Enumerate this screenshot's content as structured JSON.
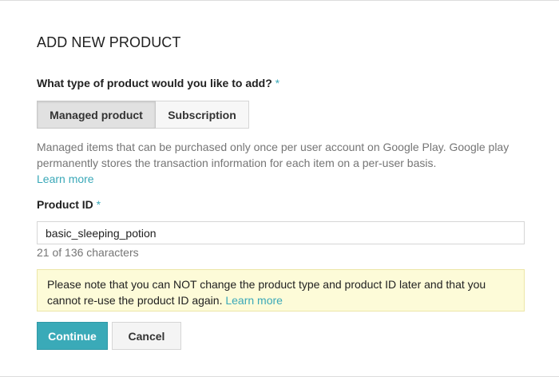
{
  "dialog": {
    "title": "ADD NEW PRODUCT",
    "product_type": {
      "question": "What type of product would you like to add?",
      "required_mark": "*",
      "options": [
        {
          "label": "Managed product",
          "selected": true
        },
        {
          "label": "Subscription",
          "selected": false
        }
      ],
      "description": "Managed items that can be purchased only once per user account on Google Play. Google play permanently stores the transaction information for each item on a per-user basis.",
      "learn_more": "Learn more"
    },
    "product_id": {
      "label": "Product ID",
      "required_mark": "*",
      "value": "basic_sleeping_potion",
      "counter": "21 of 136 characters"
    },
    "note": {
      "text": "Please note that you can NOT change the product type and product ID later and that you cannot re-use the product ID again.",
      "learn_more": "Learn more"
    },
    "buttons": {
      "continue": "Continue",
      "cancel": "Cancel"
    }
  },
  "colors": {
    "accent": "#3aaab8",
    "note_background": "#fdfbd8"
  }
}
